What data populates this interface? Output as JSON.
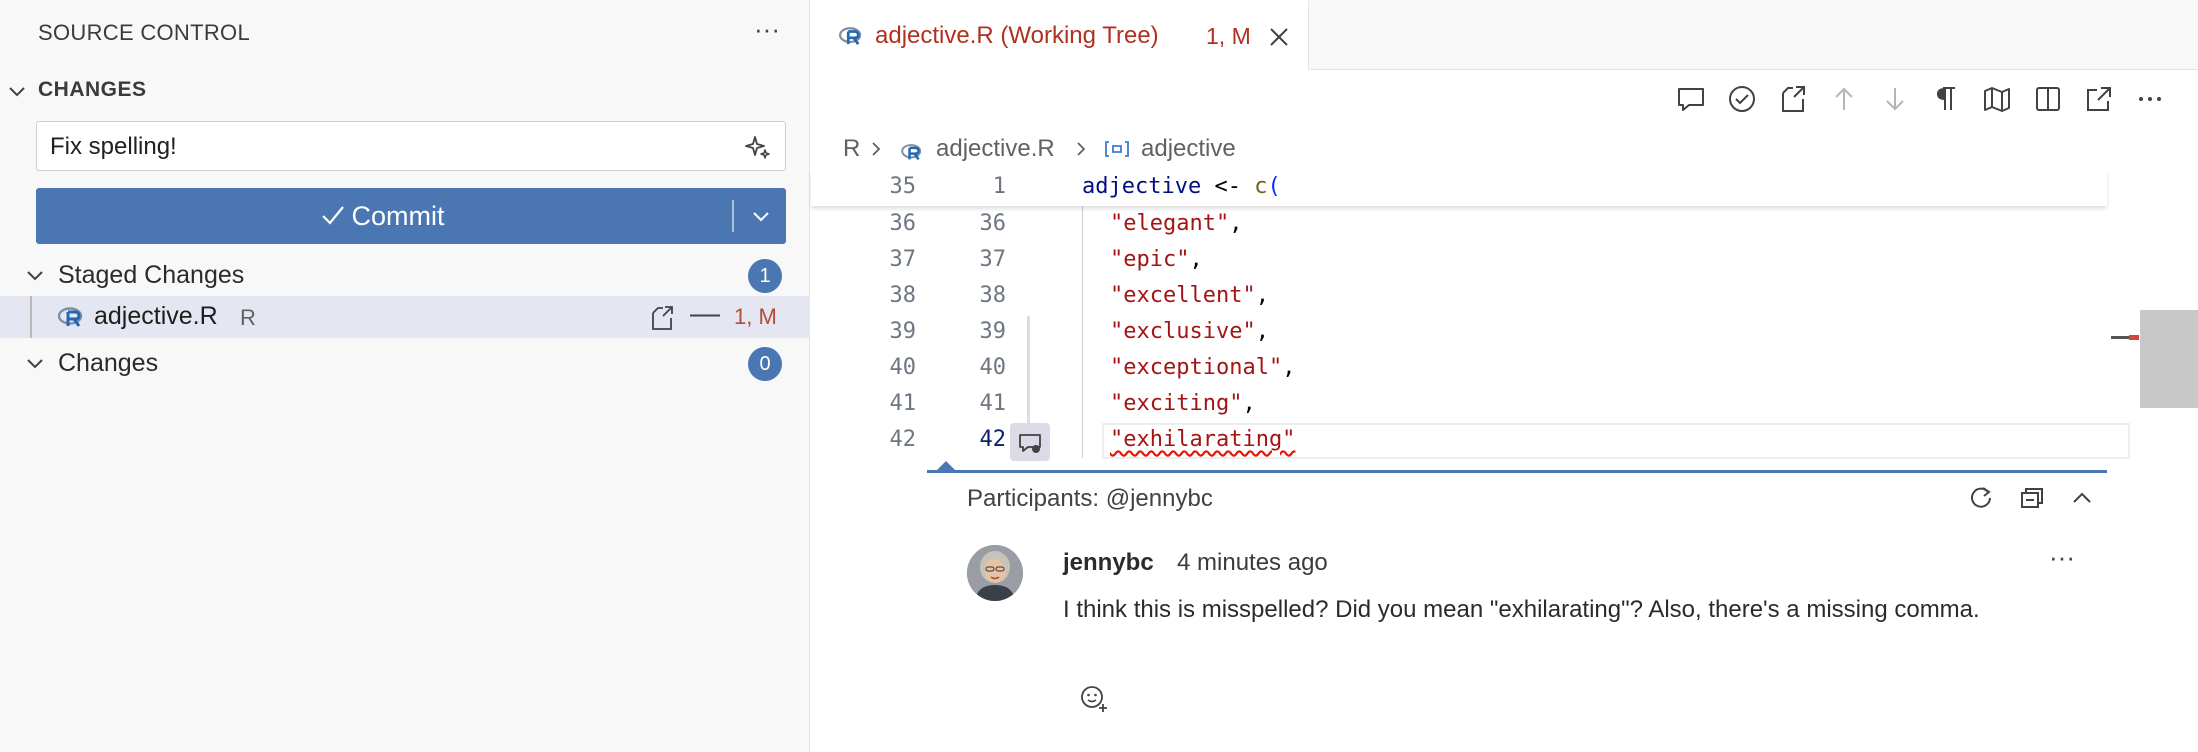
{
  "sidebar": {
    "title": "SOURCE CONTROL",
    "more_label": "···",
    "section_title": "CHANGES",
    "commit_message": "Fix spelling!",
    "commit_label": "Commit",
    "groups": [
      {
        "label": "Staged Changes",
        "count": "1"
      },
      {
        "label": "Changes",
        "count": "0"
      }
    ],
    "staged_file": {
      "name": "adjective.R",
      "dir": "R",
      "unstage_glyph": "—",
      "status": "1, M"
    }
  },
  "tab": {
    "label": "adjective.R (Working Tree)",
    "status": "1, M"
  },
  "breadcrumb": {
    "folder": "R",
    "file": "adjective.R",
    "symbol": "adjective"
  },
  "editor": {
    "sticky": {
      "old_line": "35",
      "new_line": "1",
      "ident": "adjective",
      "op": " <- ",
      "fn": "c",
      "paren": "("
    },
    "lines": [
      {
        "old": "36",
        "new": "36",
        "text": "\"elegant\"",
        "trail": ","
      },
      {
        "old": "37",
        "new": "37",
        "text": "\"epic\"",
        "trail": ","
      },
      {
        "old": "38",
        "new": "38",
        "text": "\"excellent\"",
        "trail": ","
      },
      {
        "old": "39",
        "new": "39",
        "text": "\"exclusive\"",
        "trail": ","
      },
      {
        "old": "40",
        "new": "40",
        "text": "\"exceptional\"",
        "trail": ","
      },
      {
        "old": "41",
        "new": "41",
        "text": "\"exciting\"",
        "trail": ","
      },
      {
        "old": "42",
        "new": "42",
        "text": "\"exhilarating\"",
        "trail": ""
      }
    ]
  },
  "comment": {
    "participants": "Participants: @jennybc",
    "author": "jennybc",
    "time": "4 minutes ago",
    "more_label": "···",
    "body": "I think this is misspelled? Did you mean \"exhilarating\"? Also, there's a missing comma."
  },
  "toolbar_icons": [
    "comment-icon",
    "check-circle-icon",
    "open-file-icon",
    "arrow-up-icon",
    "arrow-down-icon",
    "pilcrow-icon",
    "map-icon",
    "split-editor-icon",
    "open-external-icon",
    "more-icon"
  ],
  "colors": {
    "accent": "#4a77b2",
    "modified": "#b0311f",
    "string": "#a31515",
    "keyword": "#001080"
  }
}
